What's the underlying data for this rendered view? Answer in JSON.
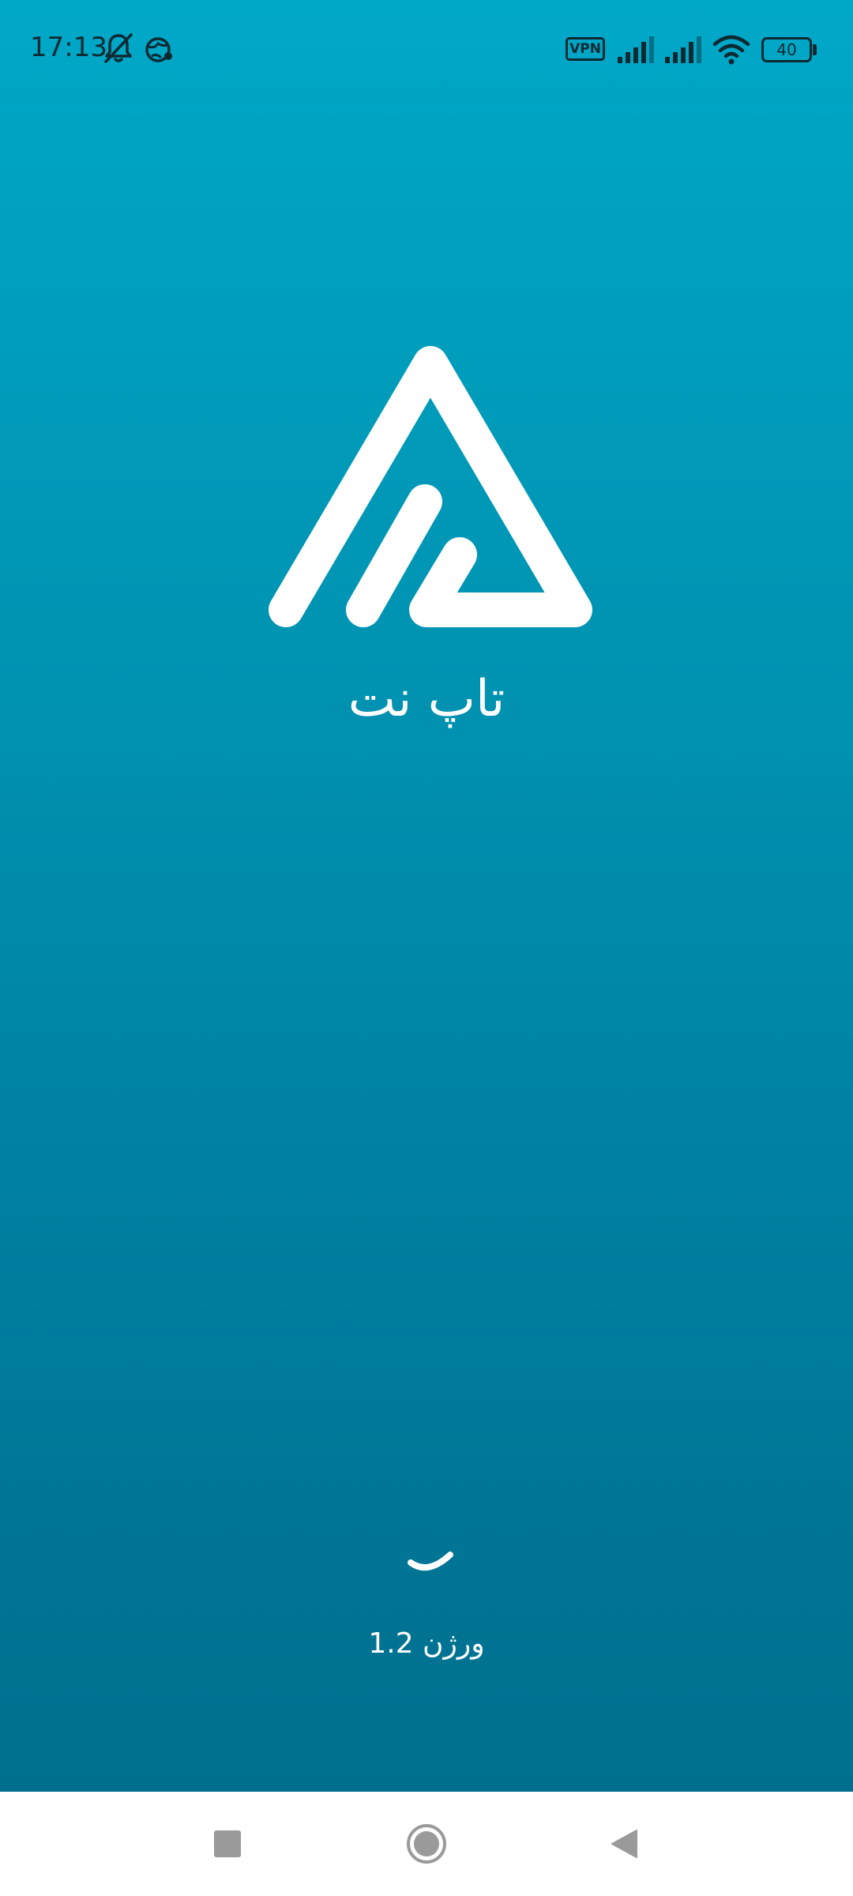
{
  "status_bar": {
    "time": "17:13",
    "icons": [
      "notifications-off-icon",
      "globe-icon",
      "vpn-icon",
      "signal-icon",
      "signal-icon",
      "wifi-icon",
      "battery-icon"
    ],
    "vpn_label": "VPN",
    "battery_level": "40"
  },
  "splash": {
    "app_name": "تاپ نت",
    "version_label": "ورژن 1.2",
    "background_colors": [
      "#00a8c7",
      "#006f8f"
    ],
    "loading": true
  },
  "navigation_bar": {
    "buttons": [
      "recents-button",
      "home-button",
      "back-button"
    ]
  }
}
